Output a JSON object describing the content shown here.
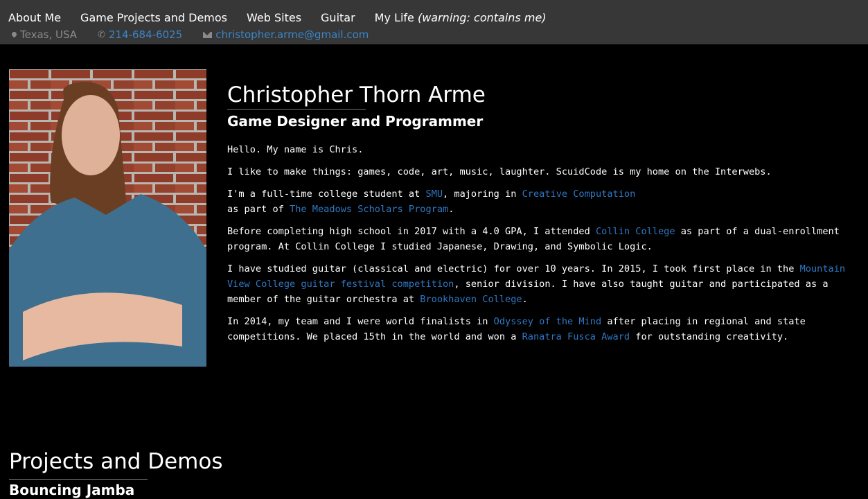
{
  "nav": {
    "items": [
      {
        "label": "About Me"
      },
      {
        "label": "Game Projects and Demos"
      },
      {
        "label": "Web Sites"
      },
      {
        "label": "Guitar"
      }
    ],
    "life_label": "My Life",
    "life_warning": "(warning: contains me)"
  },
  "contact": {
    "location": "Texas, USA",
    "phone": "214-684-6025",
    "email": "christopher.arme@gmail.com"
  },
  "profile": {
    "name": "Christopher Thorn Arme",
    "title": "Game Designer and Programmer"
  },
  "bio": {
    "p1": "Hello. My name is Chris.",
    "p2": "I like to make things: games, code, art, music, laughter. ScuidCode is my home on the Interwebs.",
    "p3_a": "I'm a full-time college student at ",
    "p3_link1": "SMU",
    "p3_b": ", majoring in ",
    "p3_link2": "Creative Computation",
    "p3_c": "as part of ",
    "p3_link3": "The Meadows Scholars Program",
    "p3_d": ".",
    "p4_a": "Before completing high school in 2017 with a 4.0 GPA, I attended ",
    "p4_link1": "Collin College",
    "p4_b": " as part of a dual-enrollment program. At Collin College I studied Japanese, Drawing, and Symbolic Logic.",
    "p5_a": "I have studied guitar (classical and electric) for over 10 years. In 2015, I took first place in the ",
    "p5_link1": "Mountain View College guitar festival competition",
    "p5_b": ", senior division. I have also taught guitar and participated as a member of the guitar orchestra at ",
    "p5_link2": "Brookhaven College",
    "p5_c": ".",
    "p6_a": "In 2014, my team and I were world finalists in ",
    "p6_link1": "Odyssey of the Mind",
    "p6_b": " after placing in regional and state competitions. We placed 15th in the world and won a ",
    "p6_link2": "Ranatra Fusca Award",
    "p6_c": " for outstanding creativity."
  },
  "projects": {
    "title": "Projects and Demos",
    "subtitle": "Bouncing Jamba"
  },
  "colors": {
    "topbar": "#373737",
    "link": "#2f78c4",
    "background": "#000000"
  },
  "icons": {
    "location": "map-marker-icon",
    "phone": "phone-icon",
    "email": "envelope-icon"
  }
}
